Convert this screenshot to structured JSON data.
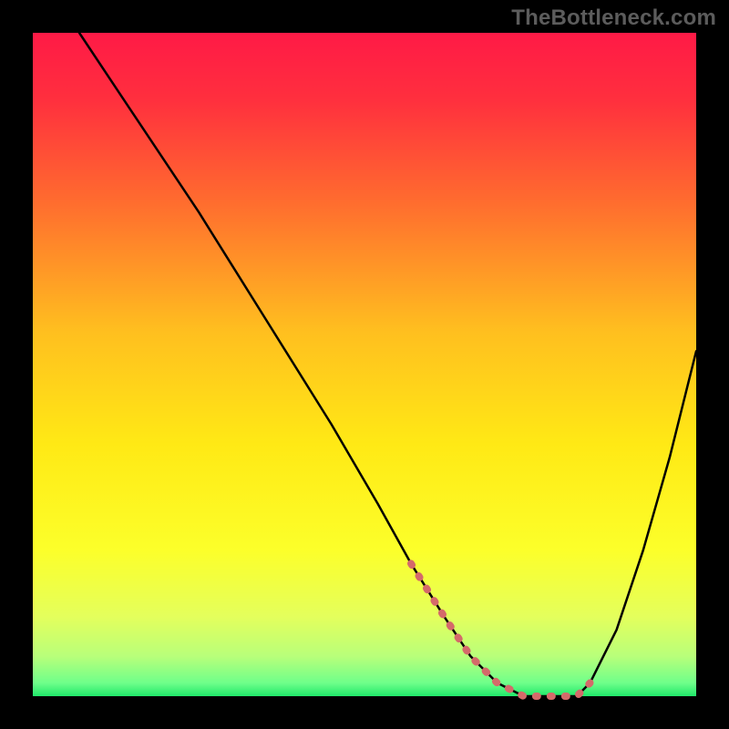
{
  "watermark": "TheBottleneck.com",
  "gradient": {
    "stops": [
      {
        "pct": 0,
        "color": "#ff1a46"
      },
      {
        "pct": 10,
        "color": "#ff2f3e"
      },
      {
        "pct": 25,
        "color": "#ff6a2f"
      },
      {
        "pct": 45,
        "color": "#ffbf1f"
      },
      {
        "pct": 62,
        "color": "#ffe915"
      },
      {
        "pct": 78,
        "color": "#fcff2a"
      },
      {
        "pct": 88,
        "color": "#e4ff5c"
      },
      {
        "pct": 94,
        "color": "#b8ff7a"
      },
      {
        "pct": 98,
        "color": "#6fff8a"
      },
      {
        "pct": 100,
        "color": "#20e86a"
      }
    ]
  },
  "curve_color": "#000000",
  "highlight_color": "#d46a6a",
  "chart_data": {
    "type": "line",
    "title": "",
    "xlabel": "",
    "ylabel": "",
    "xlim": [
      0,
      100
    ],
    "ylim": [
      0,
      100
    ],
    "legend": false,
    "grid": false,
    "series": [
      {
        "name": "curve",
        "x": [
          7,
          15,
          25,
          35,
          45,
          52,
          57,
          62,
          66,
          70,
          74,
          78,
          82,
          84,
          88,
          92,
          96,
          100
        ],
        "values": [
          100,
          88,
          73,
          57,
          41,
          29,
          20,
          12,
          6,
          2,
          0,
          0,
          0,
          2,
          10,
          22,
          36,
          52
        ]
      }
    ],
    "highlight_segment": {
      "x": [
        57,
        62,
        66,
        70,
        74,
        78,
        82,
        84
      ],
      "values": [
        20,
        12,
        6,
        2,
        0,
        0,
        0,
        2
      ],
      "note": "pink/salmon dashed segment near valley"
    }
  }
}
